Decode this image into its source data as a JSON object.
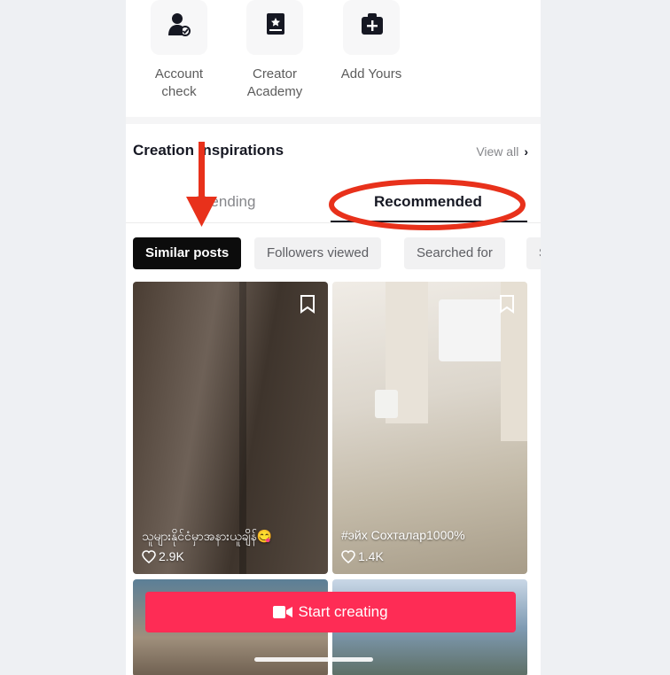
{
  "tools": [
    {
      "label_line1": "Account",
      "label_line2": "check",
      "icon": "account-check-icon"
    },
    {
      "label_line1": "Creator",
      "label_line2": "Academy",
      "icon": "creator-academy-icon"
    },
    {
      "label_line1": "Add Yours",
      "label_line2": "",
      "icon": "add-yours-icon"
    }
  ],
  "inspirations": {
    "title": "Creation inspirations",
    "view_all": "View all",
    "chevron": "›"
  },
  "tabs": [
    {
      "label": "Trending",
      "selected": false
    },
    {
      "label": "Recommended",
      "selected": true
    }
  ],
  "filters": [
    "Similar posts",
    "Followers viewed",
    "Searched for",
    "S"
  ],
  "posts": [
    {
      "caption": "သူများနိုင်ငံမှာအနားယူချိန်😋",
      "likes": "2.9K"
    },
    {
      "caption": "#эйх Сохталар1000%",
      "likes": "1.4K"
    }
  ],
  "cta": {
    "label": "Start creating",
    "icon": "video-camera-icon"
  },
  "colors": {
    "accent": "#fe2c55",
    "annotation": "#e8311b"
  }
}
